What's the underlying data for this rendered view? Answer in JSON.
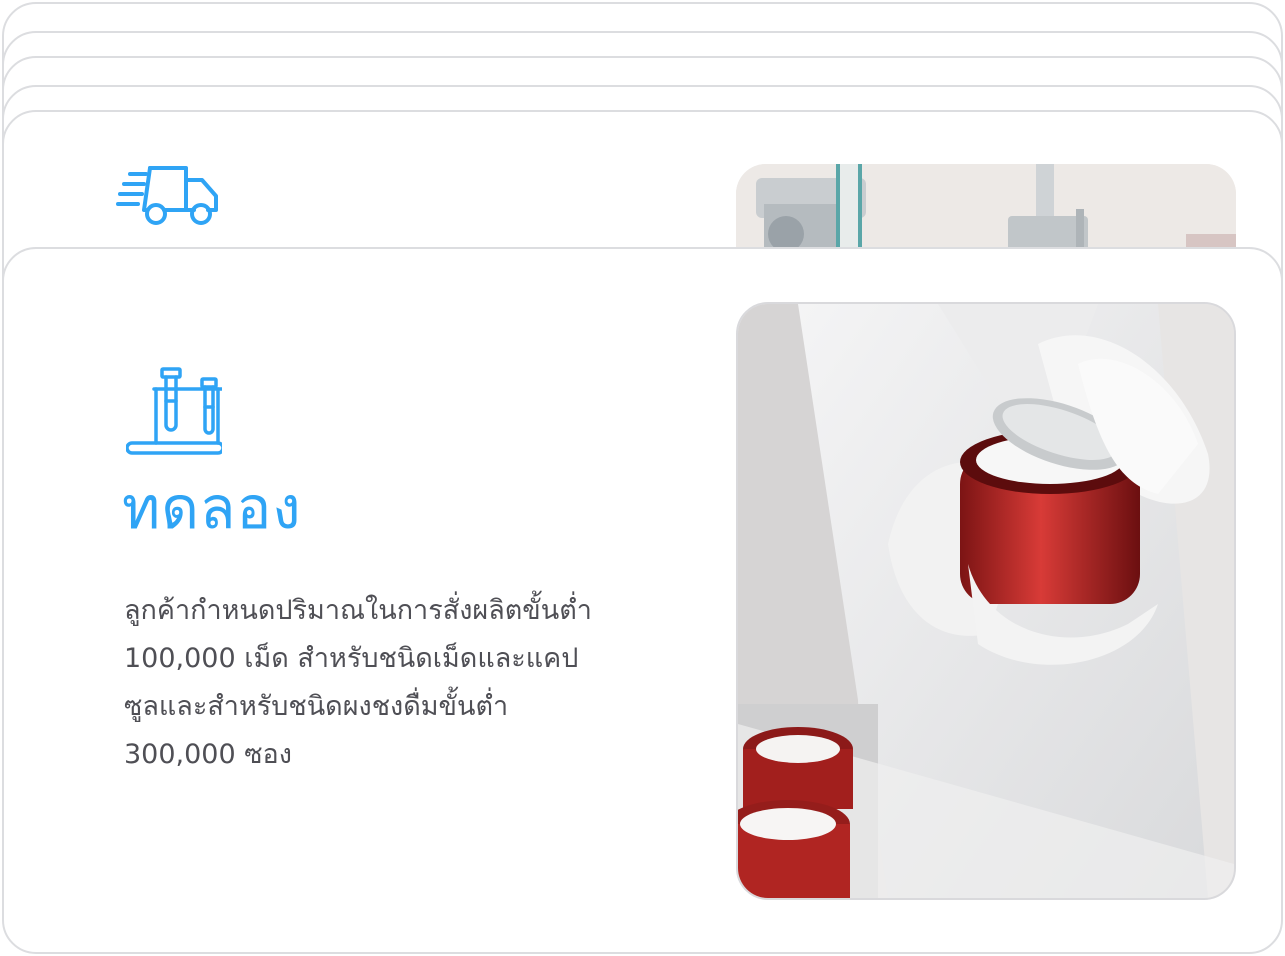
{
  "stack": {
    "back_card": {
      "icon": "delivery-truck-icon"
    },
    "front_card": {
      "icon": "test-tubes-icon",
      "title": "ทดลอง",
      "description": "ลูกค้ากำหนดปริมาณในการสั่งผลิตขั้นต่ำ\n100,000 เม็ด สำหรับชนิดเม็ดและแคป\nซูลและสำหรับชนิดผงชงดื่มขั้นต่ำ\n300,000 ซอง"
    }
  },
  "colors": {
    "accent": "#2fa4f5",
    "body_text": "#4f4f55",
    "card_border": "#dcdde0"
  }
}
